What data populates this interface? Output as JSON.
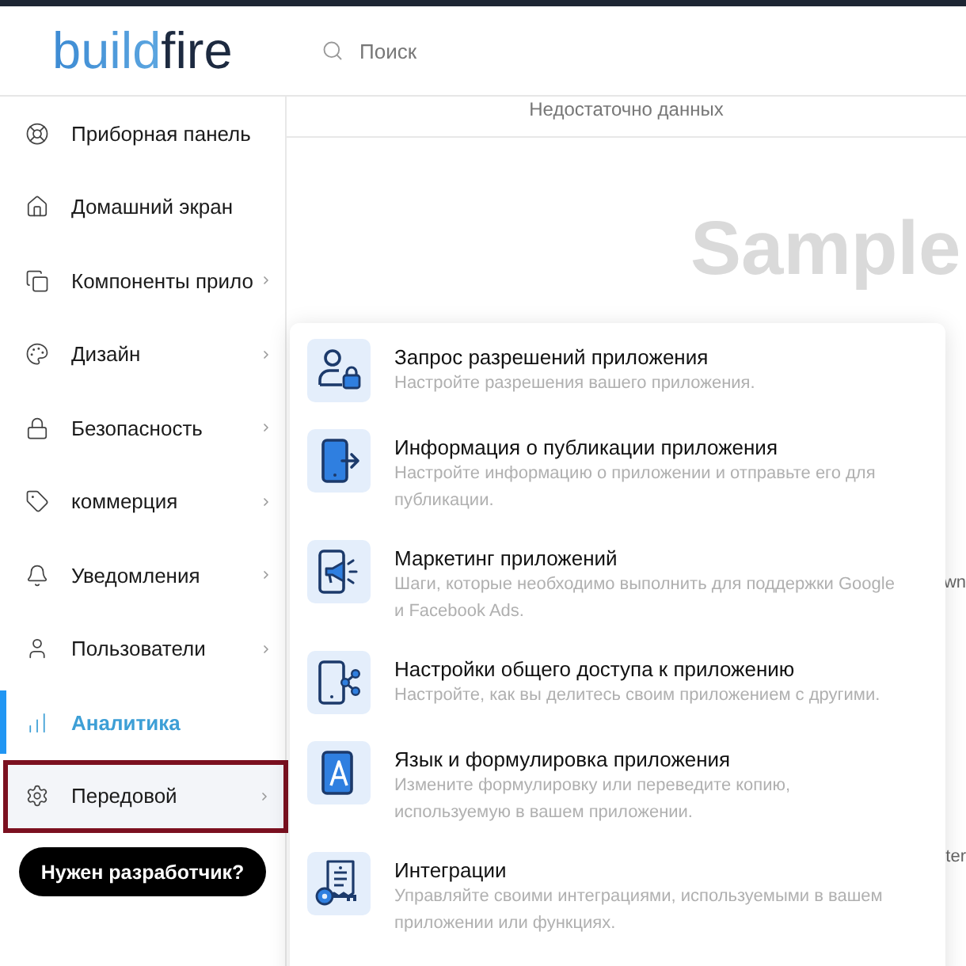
{
  "header": {
    "logo": "buildfire",
    "search": {
      "placeholder": "Поиск"
    }
  },
  "sidebar": {
    "items": [
      {
        "label": "Приборная панель",
        "selected": false,
        "expanded": false,
        "has_submenu": false
      },
      {
        "label": "Домашний экран",
        "selected": false,
        "expanded": false,
        "has_submenu": false
      },
      {
        "label": "Компоненты прило",
        "selected": false,
        "expanded": false,
        "has_submenu": true
      },
      {
        "label": "Дизайн",
        "selected": false,
        "expanded": false,
        "has_submenu": true
      },
      {
        "label": "Безопасность",
        "selected": false,
        "expanded": false,
        "has_submenu": true
      },
      {
        "label": "коммерция",
        "selected": false,
        "expanded": false,
        "has_submenu": true
      },
      {
        "label": "Уведомления",
        "selected": false,
        "expanded": false,
        "has_submenu": true
      },
      {
        "label": "Пользователи",
        "selected": false,
        "expanded": false,
        "has_submenu": true
      },
      {
        "label": "Аналитика",
        "selected": true,
        "expanded": false,
        "has_submenu": false
      },
      {
        "label": "Передовой",
        "selected": false,
        "expanded": true,
        "has_submenu": true
      }
    ],
    "developer_button": "Нужен разработчик?"
  },
  "content": {
    "notice": "Недостаточно данных",
    "sample_label": "Sample",
    "edge_fragments": [
      "wn",
      "ter"
    ]
  },
  "dropdown": {
    "items": [
      {
        "title": "Запрос разрешений приложения",
        "description": "Настройте разрешения вашего приложения."
      },
      {
        "title": "Информация о публикации приложения",
        "description": "Настройте информацию о приложении и отправьте его для публикации."
      },
      {
        "title": "Маркетинг приложений",
        "description": "Шаги, которые необходимо выполнить для поддержки Google и Facebook Ads."
      },
      {
        "title": "Настройки общего доступа к приложению",
        "description": "Настройте, как вы делитесь своим приложением с другими."
      },
      {
        "title": "Язык и формулировка приложения",
        "description": "Измените формулировку или переведите копию, используемую в вашем приложении."
      },
      {
        "title": "Интеграции",
        "description": "Управляйте своими интеграциями, используемыми в вашем приложении или функциях."
      }
    ]
  }
}
